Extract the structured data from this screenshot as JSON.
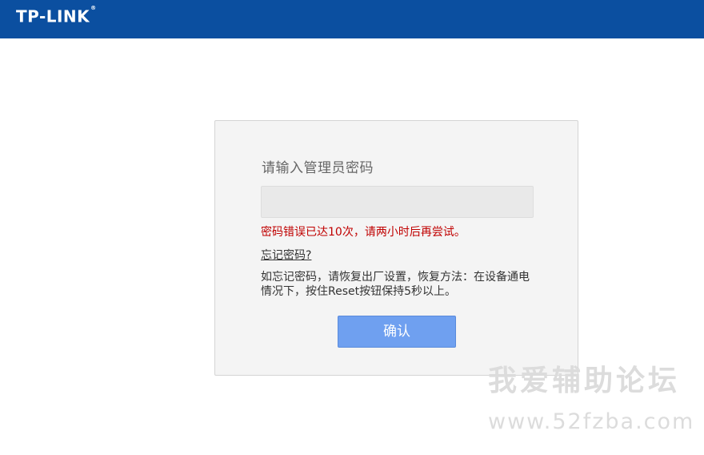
{
  "header": {
    "logo_text": "TP-LINK",
    "logo_mark": "®"
  },
  "login": {
    "prompt": "请输入管理员密码",
    "password_value": "",
    "error_message": "密码错误已达10次，请两小时后再尝试。",
    "forgot_link": "忘记密码?",
    "help_text": "如忘记密码，请恢复出厂设置，恢复方法：在设备通电情况下，按住Reset按钮保持5秒以上。",
    "confirm_label": "确认"
  },
  "watermark": {
    "text": "我爱辅助论坛",
    "url": "www.52fzba.com"
  },
  "colors": {
    "header_bg": "#0b4fa0",
    "error": "#c00000",
    "button": "#6fa0f0"
  }
}
